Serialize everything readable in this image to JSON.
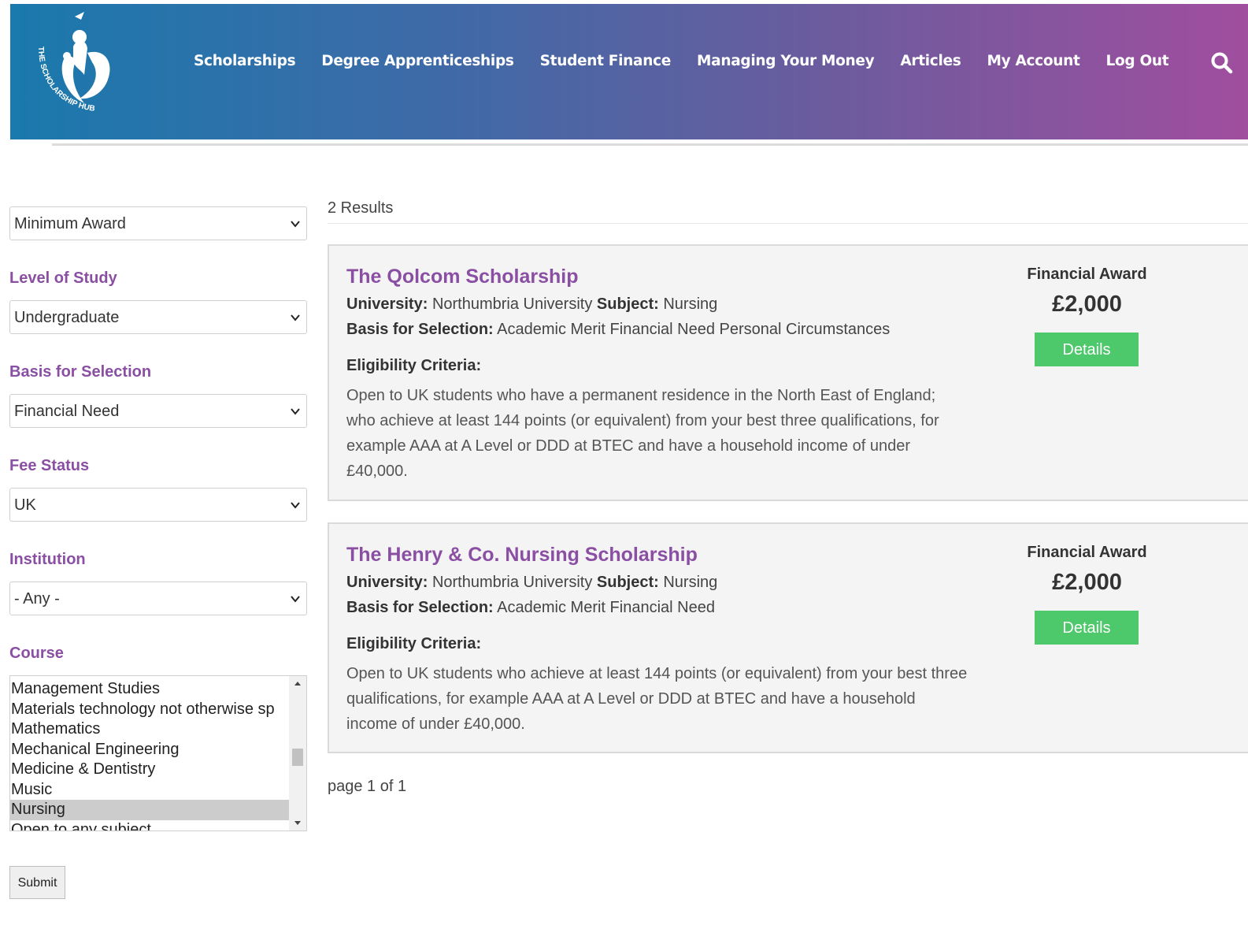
{
  "header": {
    "logo_text": "THE SCHOLARSHIP HUB",
    "nav": [
      "Scholarships",
      "Degree Apprenticeships",
      "Student Finance",
      "Managing Your Money",
      "Articles",
      "My Account",
      "Log Out"
    ],
    "search_icon": "search-icon"
  },
  "filters": {
    "award_select": "Minimum Award",
    "level_label": "Level of Study",
    "level_select": "Undergraduate",
    "basis_label": "Basis for Selection",
    "basis_select": "Financial Need",
    "fee_label": "Fee Status",
    "fee_select": "UK",
    "institution_label": "Institution",
    "institution_select": "- Any -",
    "course_label": "Course",
    "course_options": [
      "Management Studies",
      "Materials technology not otherwise sp",
      "Mathematics",
      "Mechanical Engineering",
      "Medicine & Dentistry",
      "Music",
      "Nursing",
      "Open to any subject"
    ],
    "course_selected": "Nursing",
    "submit_label": "Submit"
  },
  "results": {
    "count": "2 Results",
    "items": [
      {
        "title": "The Qolcom Scholarship",
        "university_label": "University:",
        "university": "Northumbria University",
        "subject_label": "Subject:",
        "subject": "Nursing",
        "basis_label": "Basis for Selection:",
        "basis": "Academic Merit Financial Need Personal Circumstances",
        "eligibility_label": "Eligibility Criteria:",
        "eligibility": "Open to UK students who have a permanent residence in the North East of England; who achieve at least 144 points (or equivalent) from your best three qualifications, for example AAA at A Level or DDD at BTEC and have a household income of under £40,000.",
        "award_label": "Financial Award",
        "award": "£2,000",
        "details_label": "Details"
      },
      {
        "title": "The Henry & Co. Nursing Scholarship",
        "university_label": "University:",
        "university": "Northumbria University",
        "subject_label": "Subject:",
        "subject": "Nursing",
        "basis_label": "Basis for Selection:",
        "basis": "Academic Merit Financial Need",
        "eligibility_label": "Eligibility Criteria:",
        "eligibility": "Open to UK students who achieve at least 144 points (or equivalent) from your best three qualifications, for example AAA at A Level or DDD at BTEC and have a household income of under £40,000.",
        "award_label": "Financial Award",
        "award": "£2,000",
        "details_label": "Details"
      }
    ],
    "pagination": "page 1 of 1"
  },
  "colors": {
    "accent_purple": "#8a4fa3",
    "details_green": "#4dc86a",
    "header_gradient_start": "#1a79ad",
    "header_gradient_end": "#a04e9e"
  }
}
